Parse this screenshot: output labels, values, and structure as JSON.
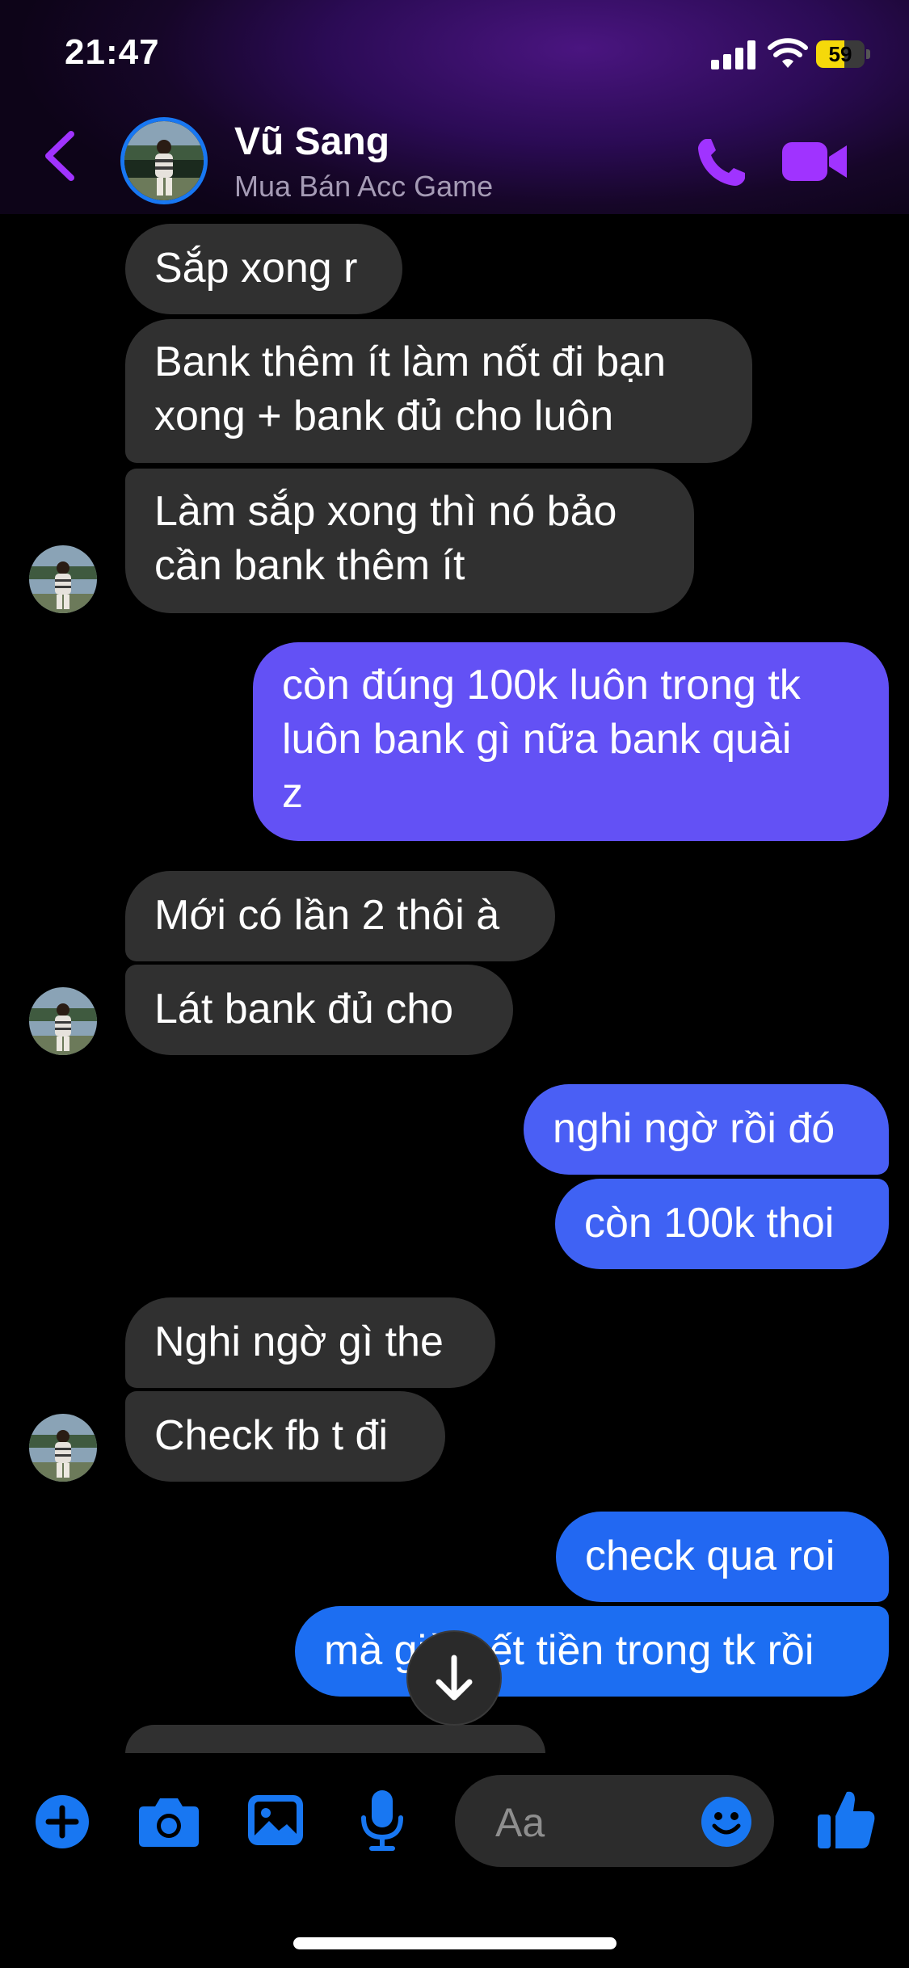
{
  "status_bar": {
    "time": "21:47",
    "battery": "59"
  },
  "header": {
    "name": "Vũ Sang",
    "subtitle": "Mua Bán Acc Game"
  },
  "messages": [
    {
      "text": "Sắp xong r"
    },
    {
      "lines": [
        "Bank thêm ít làm nốt đi bạn",
        "xong + bank đủ cho luôn"
      ]
    },
    {
      "lines": [
        "Làm sắp xong thì nó bảo",
        "cần bank thêm ít"
      ]
    },
    {
      "lines": [
        "còn đúng 100k luôn trong tk",
        "luôn bank gì nữa bank quài",
        "z"
      ]
    },
    {
      "text": "Mới có lần 2 thôi à"
    },
    {
      "text": "Lát bank đủ cho"
    },
    {
      "text": "nghi ngờ rồi đó"
    },
    {
      "text": "còn 100k thoi"
    },
    {
      "text": "Nghi ngờ gì the"
    },
    {
      "text": "Check fb t đi"
    },
    {
      "text": "check qua roi"
    },
    {
      "text": "mà giờ hết tiền trong tk rồi"
    }
  ],
  "composer": {
    "placeholder": "Aa"
  },
  "colors": {
    "incoming_bubble": "#303030",
    "outgoing_purple": "#6351f5",
    "outgoing_blue": "#1c6ef2",
    "accent_purple": "#a033ff",
    "toolbar_blue": "#1877f2"
  },
  "icons": [
    "back-chevron-icon",
    "phone-icon",
    "video-camera-icon",
    "plus-icon",
    "camera-icon",
    "gallery-icon",
    "microphone-icon",
    "emoji-icon",
    "thumbs-up-icon",
    "arrow-down-icon"
  ]
}
